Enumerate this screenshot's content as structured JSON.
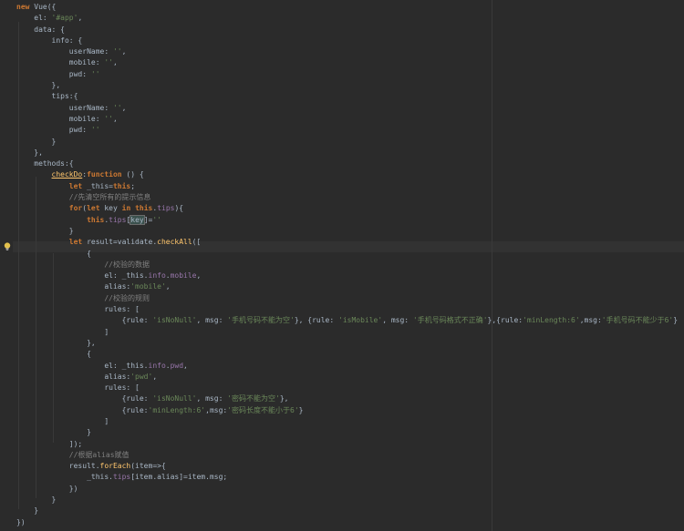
{
  "colors": {
    "background": "#2b2b2b",
    "keyword": "#cc7832",
    "string": "#6a8759",
    "property": "#9876aa",
    "function": "#ffc66d",
    "comment": "#808080",
    "plain": "#a9b7c6"
  },
  "gutter_icon": "lightbulb-icon",
  "code": {
    "lines": [
      [
        {
          "t": "new",
          "c": "kw"
        },
        {
          "t": " Vue({",
          "c": "pl"
        }
      ],
      [
        {
          "t": "    el: ",
          "c": "pl"
        },
        {
          "t": "'#app'",
          "c": "str"
        },
        {
          "t": ",",
          "c": "pl"
        }
      ],
      [
        {
          "t": "    data: {",
          "c": "pl"
        }
      ],
      [
        {
          "t": "        info: {",
          "c": "pl"
        }
      ],
      [
        {
          "t": "            userName: ",
          "c": "pl"
        },
        {
          "t": "''",
          "c": "str"
        },
        {
          "t": ",",
          "c": "pl"
        }
      ],
      [
        {
          "t": "            mobile: ",
          "c": "pl"
        },
        {
          "t": "''",
          "c": "str"
        },
        {
          "t": ",",
          "c": "pl"
        }
      ],
      [
        {
          "t": "            pwd: ",
          "c": "pl"
        },
        {
          "t": "''",
          "c": "str"
        }
      ],
      [
        {
          "t": "        },",
          "c": "pl"
        }
      ],
      [
        {
          "t": "        tips:{",
          "c": "pl"
        }
      ],
      [
        {
          "t": "            userName: ",
          "c": "pl"
        },
        {
          "t": "''",
          "c": "str"
        },
        {
          "t": ",",
          "c": "pl"
        }
      ],
      [
        {
          "t": "            mobile: ",
          "c": "pl"
        },
        {
          "t": "''",
          "c": "str"
        },
        {
          "t": ",",
          "c": "pl"
        }
      ],
      [
        {
          "t": "            pwd: ",
          "c": "pl"
        },
        {
          "t": "''",
          "c": "str"
        }
      ],
      [
        {
          "t": "        }",
          "c": "pl"
        }
      ],
      [
        {
          "t": "    },",
          "c": "pl"
        }
      ],
      [
        {
          "t": "    methods:{",
          "c": "pl"
        }
      ],
      [
        {
          "t": "        ",
          "c": "pl"
        },
        {
          "t": "checkDo",
          "c": "fn ul"
        },
        {
          "t": ":",
          "c": "pl"
        },
        {
          "t": "function",
          "c": "kw"
        },
        {
          "t": " () {",
          "c": "pl"
        }
      ],
      [
        {
          "t": "            ",
          "c": "pl"
        },
        {
          "t": "let",
          "c": "kw"
        },
        {
          "t": " _this=",
          "c": "pl"
        },
        {
          "t": "this",
          "c": "kw"
        },
        {
          "t": ";",
          "c": "pl"
        }
      ],
      [
        {
          "t": "            //先清空所有的提示信息",
          "c": "cm"
        }
      ],
      [
        {
          "t": "            ",
          "c": "pl"
        },
        {
          "t": "for",
          "c": "kw"
        },
        {
          "t": "(",
          "c": "pl"
        },
        {
          "t": "let",
          "c": "kw"
        },
        {
          "t": " key ",
          "c": "pl"
        },
        {
          "t": "in",
          "c": "kw"
        },
        {
          "t": " ",
          "c": "pl"
        },
        {
          "t": "this",
          "c": "kw"
        },
        {
          "t": ".",
          "c": "pl"
        },
        {
          "t": "tips",
          "c": "prop"
        },
        {
          "t": "){",
          "c": "pl"
        }
      ],
      [
        {
          "t": "                ",
          "c": "pl"
        },
        {
          "t": "this",
          "c": "kw"
        },
        {
          "t": ".",
          "c": "pl"
        },
        {
          "t": "tips",
          "c": "prop"
        },
        {
          "t": "[",
          "c": "pl"
        },
        {
          "t": "key",
          "c": "pl keyhl"
        },
        {
          "t": "]=",
          "c": "pl"
        },
        {
          "t": "''",
          "c": "str"
        }
      ],
      [
        {
          "t": "            }",
          "c": "pl"
        }
      ],
      [
        {
          "t": "            ",
          "c": "pl"
        },
        {
          "t": "let",
          "c": "kw"
        },
        {
          "t": " result=validate.",
          "c": "pl"
        },
        {
          "t": "checkAll",
          "c": "fn"
        },
        {
          "t": "([",
          "c": "pl"
        }
      ],
      [
        {
          "t": "                {",
          "c": "pl"
        }
      ],
      [
        {
          "t": "                    //校验的数据",
          "c": "cm"
        }
      ],
      [
        {
          "t": "                    el: _this.",
          "c": "pl"
        },
        {
          "t": "info",
          "c": "prop"
        },
        {
          "t": ".",
          "c": "pl"
        },
        {
          "t": "mobile",
          "c": "prop"
        },
        {
          "t": ",",
          "c": "pl"
        }
      ],
      [
        {
          "t": "                    alias:",
          "c": "pl"
        },
        {
          "t": "'mobile'",
          "c": "str"
        },
        {
          "t": ",",
          "c": "pl"
        }
      ],
      [
        {
          "t": "                    //校验的规则",
          "c": "cm"
        }
      ],
      [
        {
          "t": "                    rules: [",
          "c": "pl"
        }
      ],
      [
        {
          "t": "                        {rule: ",
          "c": "pl"
        },
        {
          "t": "'isNoNull'",
          "c": "str"
        },
        {
          "t": ", msg: ",
          "c": "pl"
        },
        {
          "t": "'手机号码不能为空'",
          "c": "str"
        },
        {
          "t": "}, {rule: ",
          "c": "pl"
        },
        {
          "t": "'isMobile'",
          "c": "str"
        },
        {
          "t": ", msg: ",
          "c": "pl"
        },
        {
          "t": "'手机号码格式不正确'",
          "c": "str"
        },
        {
          "t": "},{rule:",
          "c": "pl"
        },
        {
          "t": "'minLength:6'",
          "c": "str"
        },
        {
          "t": ",msg:",
          "c": "pl"
        },
        {
          "t": "'手机号码不能少于6'",
          "c": "str"
        },
        {
          "t": "}",
          "c": "pl"
        }
      ],
      [
        {
          "t": "                    ]",
          "c": "pl"
        }
      ],
      [
        {
          "t": "                },",
          "c": "pl"
        }
      ],
      [
        {
          "t": "                {",
          "c": "pl"
        }
      ],
      [
        {
          "t": "                    el: _this.",
          "c": "pl"
        },
        {
          "t": "info",
          "c": "prop"
        },
        {
          "t": ".",
          "c": "pl"
        },
        {
          "t": "pwd",
          "c": "prop"
        },
        {
          "t": ",",
          "c": "pl"
        }
      ],
      [
        {
          "t": "                    alias:",
          "c": "pl"
        },
        {
          "t": "'pwd'",
          "c": "str"
        },
        {
          "t": ",",
          "c": "pl"
        }
      ],
      [
        {
          "t": "                    rules: [",
          "c": "pl"
        }
      ],
      [
        {
          "t": "                        {rule: ",
          "c": "pl"
        },
        {
          "t": "'isNoNull'",
          "c": "str"
        },
        {
          "t": ", msg: ",
          "c": "pl"
        },
        {
          "t": "'密码不能为空'",
          "c": "str"
        },
        {
          "t": "},",
          "c": "pl"
        }
      ],
      [
        {
          "t": "                        {rule:",
          "c": "pl"
        },
        {
          "t": "'minLength:6'",
          "c": "str"
        },
        {
          "t": ",msg:",
          "c": "pl"
        },
        {
          "t": "'密码长度不能小于6'",
          "c": "str"
        },
        {
          "t": "}",
          "c": "pl"
        }
      ],
      [
        {
          "t": "                    ]",
          "c": "pl"
        }
      ],
      [
        {
          "t": "                }",
          "c": "pl"
        }
      ],
      [
        {
          "t": "            ]);",
          "c": "pl"
        }
      ],
      [
        {
          "t": "            //根据alias赋值",
          "c": "cm"
        }
      ],
      [
        {
          "t": "            result.",
          "c": "pl"
        },
        {
          "t": "forEach",
          "c": "fn"
        },
        {
          "t": "(item=>{",
          "c": "pl"
        }
      ],
      [
        {
          "t": "                _this.",
          "c": "pl"
        },
        {
          "t": "tips",
          "c": "prop"
        },
        {
          "t": "[item.alias]=item.msg;",
          "c": "pl"
        }
      ],
      [
        {
          "t": "            })",
          "c": "pl"
        }
      ],
      [
        {
          "t": "        }",
          "c": "pl"
        }
      ],
      [
        {
          "t": "    }",
          "c": "pl"
        }
      ],
      [
        {
          "t": "})",
          "c": "pl"
        }
      ]
    ]
  }
}
